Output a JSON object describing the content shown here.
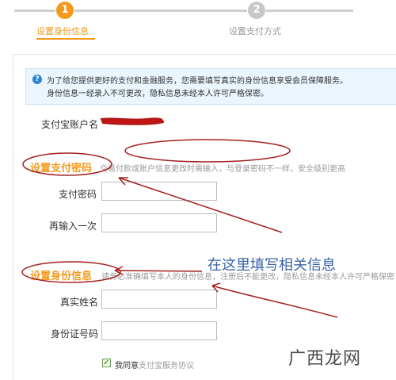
{
  "stepper": {
    "steps": [
      {
        "number": "1",
        "label": "设置身份信息"
      },
      {
        "number": "2",
        "label": "设置支付方式"
      }
    ]
  },
  "notice": {
    "line1": "为了给您提供更好的支付和金融服务，您需要填写真实的身份信息享受会员保障服务。",
    "line2": "身份信息一经录入不可更改，隐私信息未经本人许可严格保密。"
  },
  "account": {
    "label": "支付宝账户名"
  },
  "payment_password_section": {
    "title": "设置支付密码",
    "desc": "交易付款或账户信息更改时需输入，与登录密码不一样，安全级别更高",
    "password_label": "支付密码",
    "confirm_label": "再输入一次"
  },
  "identity_section": {
    "title": "设置身份信息",
    "desc": "请务必准确填写本人的身份信息，注册后不能更改，隐私信息未经本人许可严格保密",
    "name_label": "真实姓名",
    "id_label": "身份证号码"
  },
  "annotation": {
    "text": "在这里填写相关信息"
  },
  "agreement": {
    "prefix": "我同意",
    "link": "支付宝服务协议",
    "checked": "✓"
  },
  "watermark": {
    "text": "广西龙网"
  },
  "colors": {
    "accent": "#f39a1d",
    "annotation_red": "#b01818",
    "annotation_blue": "#3a63a8"
  }
}
